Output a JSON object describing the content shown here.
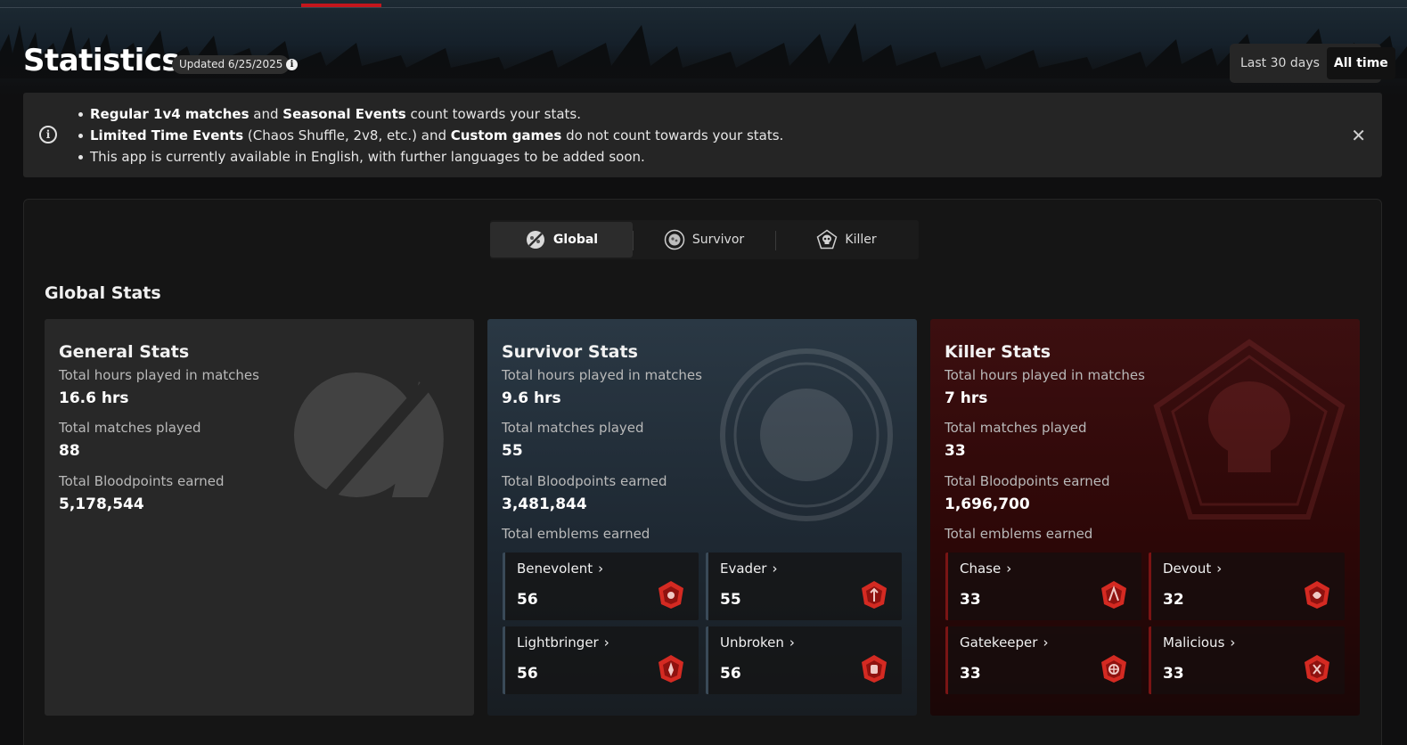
{
  "header": {
    "title": "Statistics",
    "updated": "Updated 6/25/2025",
    "info_icon": "info-icon",
    "range_options": [
      "Last 30 days",
      "All time"
    ],
    "range_selected": "All time"
  },
  "notice": {
    "line1": {
      "b1": "Regular 1v4 matches",
      "t1": " and ",
      "b2": "Seasonal Events",
      "t2": " count towards your stats."
    },
    "line2": {
      "b1": "Limited Time Events",
      "t1": " (Chaos Shuffle, 2v8, etc.) and ",
      "b2": "Custom games",
      "t2": " do not count towards your stats."
    },
    "line3": "This app is currently available in English, with further languages to be added soon.",
    "close_icon": "close-icon"
  },
  "tabs": [
    {
      "label": "Global",
      "icon": "global-icon"
    },
    {
      "label": "Survivor",
      "icon": "survivor-icon"
    },
    {
      "label": "Killer",
      "icon": "killer-icon"
    }
  ],
  "section_title": "Global Stats",
  "general": {
    "title": "General Stats",
    "hours_label": "Total hours played in matches",
    "hours_value": "16.6 hrs",
    "matches_label": "Total matches played",
    "matches_value": "88",
    "bp_label": "Total Bloodpoints earned",
    "bp_value": "5,178,544"
  },
  "survivor": {
    "title": "Survivor Stats",
    "hours_label": "Total hours played in matches",
    "hours_value": "9.6 hrs",
    "matches_label": "Total matches played",
    "matches_value": "55",
    "bp_label": "Total Bloodpoints earned",
    "bp_value": "3,481,844",
    "emblems_label": "Total emblems earned",
    "emblems": [
      {
        "name": "Benevolent",
        "value": "56"
      },
      {
        "name": "Evader",
        "value": "55"
      },
      {
        "name": "Lightbringer",
        "value": "56"
      },
      {
        "name": "Unbroken",
        "value": "56"
      }
    ]
  },
  "killer": {
    "title": "Killer Stats",
    "hours_label": "Total hours played in matches",
    "hours_value": "7 hrs",
    "matches_label": "Total matches played",
    "matches_value": "33",
    "bp_label": "Total Bloodpoints earned",
    "bp_value": "1,696,700",
    "emblems_label": "Total emblems earned",
    "emblems": [
      {
        "name": "Chase",
        "value": "33"
      },
      {
        "name": "Devout",
        "value": "32"
      },
      {
        "name": "Gatekeeper",
        "value": "33"
      },
      {
        "name": "Malicious",
        "value": "33"
      }
    ]
  },
  "colors": {
    "accent_red": "#c4161c",
    "emblem_red": "#d42a22",
    "survivor_card": "#2a3844",
    "killer_card": "#3c0f10"
  }
}
